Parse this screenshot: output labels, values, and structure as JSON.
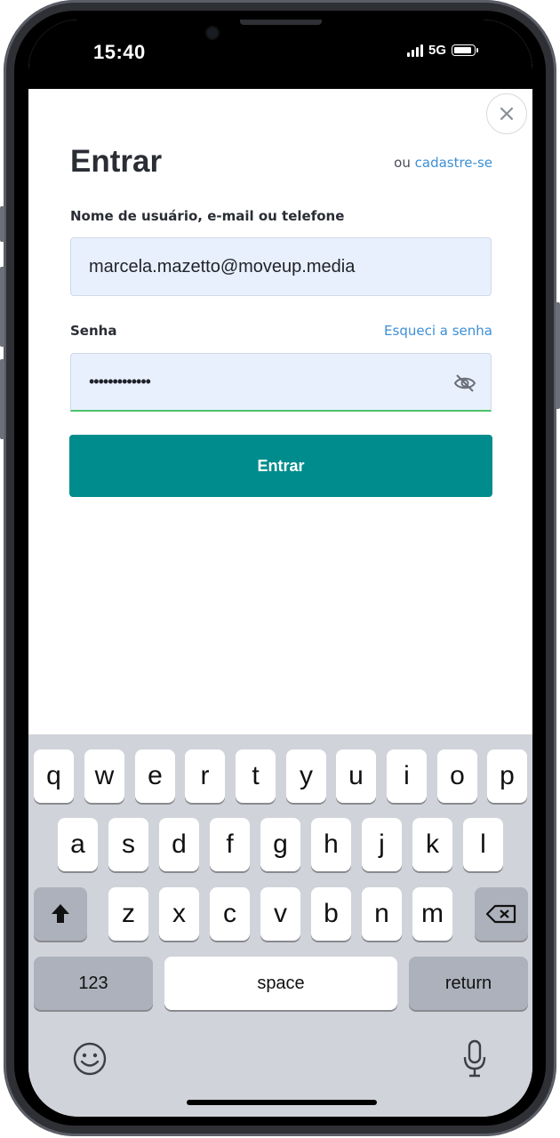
{
  "status_bar": {
    "time": "15:40",
    "network": "5G"
  },
  "login": {
    "title": "Entrar",
    "signup_prefix": "ou",
    "signup_link": "cadastre-se",
    "username_label": "Nome de usuário, e-mail ou telefone",
    "username_value": "marcela.mazetto@moveup.media",
    "password_label": "Senha",
    "forgot_link": "Esqueci a senha",
    "password_value": "•••••••••••••",
    "submit_label": "Entrar",
    "close_symbol": "×"
  },
  "icons": [
    "close-icon",
    "eye-off-icon",
    "shift-icon",
    "backspace-icon",
    "emoji-icon",
    "microphone-icon"
  ],
  "colors": {
    "accent": "#008c8c",
    "link": "#3d8fd6",
    "input_bg": "#e8f0fe",
    "focus_border": "#49c26a",
    "keyboard_bg": "#d1d3da"
  },
  "keyboard": {
    "row1": [
      "q",
      "w",
      "e",
      "r",
      "t",
      "y",
      "u",
      "i",
      "o",
      "p"
    ],
    "row2": [
      "a",
      "s",
      "d",
      "f",
      "g",
      "h",
      "j",
      "k",
      "l"
    ],
    "row3": [
      "z",
      "x",
      "c",
      "v",
      "b",
      "n",
      "m"
    ],
    "numbers_label": "123",
    "space_label": "space",
    "return_label": "return"
  }
}
